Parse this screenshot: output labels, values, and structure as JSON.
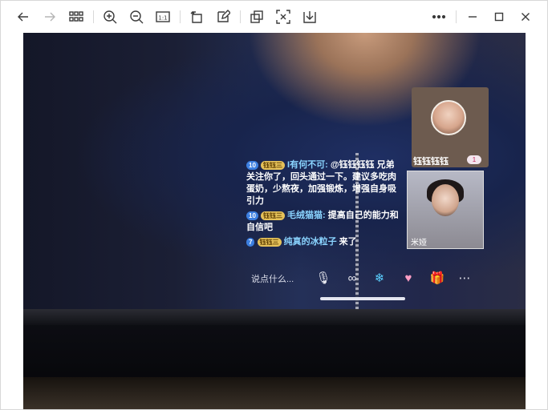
{
  "toolbar": {
    "buttons": [
      {
        "name": "back-button",
        "icon": "arrow-left-icon"
      },
      {
        "name": "forward-button",
        "icon": "arrow-right-icon"
      },
      {
        "name": "grid-view-button",
        "icon": "grid-icon"
      },
      {
        "name": "zoom-in-button",
        "icon": "zoom-in-icon"
      },
      {
        "name": "zoom-out-button",
        "icon": "zoom-out-icon"
      },
      {
        "name": "actual-size-button",
        "icon": "one-to-one-icon"
      },
      {
        "name": "rotate-button",
        "icon": "rotate-icon"
      },
      {
        "name": "edit-button",
        "icon": "edit-icon"
      },
      {
        "name": "copy-button",
        "icon": "copy-icon"
      },
      {
        "name": "extract-text-button",
        "icon": "text-extract-icon"
      },
      {
        "name": "save-button",
        "icon": "download-icon"
      },
      {
        "name": "more-button",
        "icon": "more-icon"
      },
      {
        "name": "minimize-button",
        "icon": "minimize-icon"
      },
      {
        "name": "maximize-button",
        "icon": "maximize-icon"
      },
      {
        "name": "close-button",
        "icon": "close-icon"
      }
    ],
    "actual_size_label": "1:1"
  },
  "photo": {
    "cam1_name": "钰钰钰钰",
    "cam1_badge": "1",
    "cam2_name": "米娅",
    "chat": [
      {
        "level": "10",
        "fan": "钰钰三",
        "user": "I有何不可:",
        "text": "@钰钰钰钰 兄弟关注你了，回头通过一下。建议多吃肉蛋奶，少熬夜，加强锻炼，增强自身吸引力"
      },
      {
        "level": "10",
        "fan": "钰钰三",
        "user": "毛绒猫猫:",
        "text": "提高自己的能力和自信吧"
      },
      {
        "level": "7",
        "fan": "钰钰三",
        "user": "纯真的冰粒子",
        "text": "来了"
      }
    ],
    "input_placeholder": "说点什么...",
    "colors": {
      "level_badge": "#3c7fe0",
      "fan_badge": "#e6c25a",
      "username": "#8ad4ff"
    }
  }
}
